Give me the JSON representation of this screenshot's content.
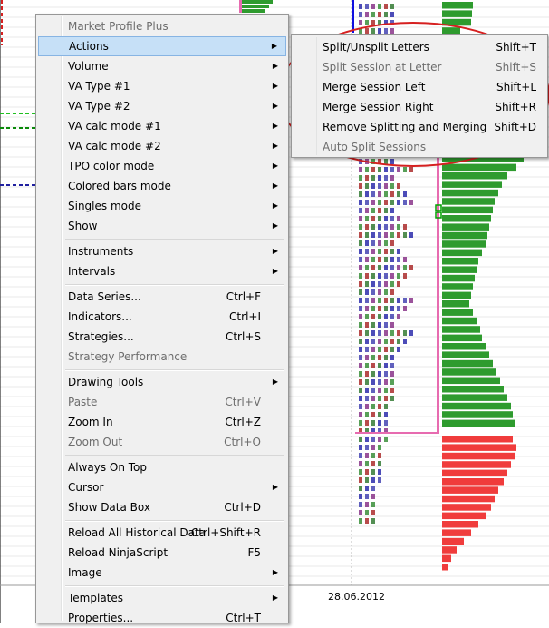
{
  "context_menu": {
    "items": [
      {
        "label": "Market Profile Plus",
        "shortcut": "",
        "submenu": false,
        "disabled": true
      },
      {
        "label": "Actions",
        "shortcut": "",
        "submenu": true,
        "disabled": false,
        "highlighted": true
      },
      {
        "label": "Volume",
        "shortcut": "",
        "submenu": true,
        "disabled": false
      },
      {
        "label": "VA Type #1",
        "shortcut": "",
        "submenu": true,
        "disabled": false
      },
      {
        "label": "VA Type #2",
        "shortcut": "",
        "submenu": true,
        "disabled": false
      },
      {
        "label": "VA calc mode #1",
        "shortcut": "",
        "submenu": true,
        "disabled": false
      },
      {
        "label": "VA calc mode #2",
        "shortcut": "",
        "submenu": true,
        "disabled": false
      },
      {
        "label": "TPO color mode",
        "shortcut": "",
        "submenu": true,
        "disabled": false
      },
      {
        "label": "Colored bars mode",
        "shortcut": "",
        "submenu": true,
        "disabled": false
      },
      {
        "label": "Singles mode",
        "shortcut": "",
        "submenu": true,
        "disabled": false
      },
      {
        "label": "Show",
        "shortcut": "",
        "submenu": true,
        "disabled": false
      },
      {
        "separator": true
      },
      {
        "label": "Instruments",
        "shortcut": "",
        "submenu": true,
        "disabled": false
      },
      {
        "label": "Intervals",
        "shortcut": "",
        "submenu": true,
        "disabled": false
      },
      {
        "separator": true
      },
      {
        "label": "Data Series...",
        "shortcut": "Ctrl+F",
        "submenu": false,
        "disabled": false
      },
      {
        "label": "Indicators...",
        "shortcut": "Ctrl+I",
        "submenu": false,
        "disabled": false
      },
      {
        "label": "Strategies...",
        "shortcut": "Ctrl+S",
        "submenu": false,
        "disabled": false
      },
      {
        "label": "Strategy Performance",
        "shortcut": "",
        "submenu": false,
        "disabled": true
      },
      {
        "separator": true
      },
      {
        "label": "Drawing Tools",
        "shortcut": "",
        "submenu": true,
        "disabled": false
      },
      {
        "label": "Paste",
        "shortcut": "Ctrl+V",
        "submenu": false,
        "disabled": true
      },
      {
        "label": "Zoom In",
        "shortcut": "Ctrl+Z",
        "submenu": false,
        "disabled": false
      },
      {
        "label": "Zoom Out",
        "shortcut": "Ctrl+O",
        "submenu": false,
        "disabled": true
      },
      {
        "separator": true
      },
      {
        "label": "Always On Top",
        "shortcut": "",
        "submenu": false,
        "disabled": false
      },
      {
        "label": "Cursor",
        "shortcut": "",
        "submenu": true,
        "disabled": false
      },
      {
        "label": "Show Data Box",
        "shortcut": "Ctrl+D",
        "submenu": false,
        "disabled": false
      },
      {
        "separator": true
      },
      {
        "label": "Reload All Historical Data",
        "shortcut": "Ctrl+Shift+R",
        "submenu": false,
        "disabled": false
      },
      {
        "label": "Reload NinjaScript",
        "shortcut": "F5",
        "submenu": false,
        "disabled": false
      },
      {
        "label": "Image",
        "shortcut": "",
        "submenu": true,
        "disabled": false
      },
      {
        "separator": true
      },
      {
        "label": "Templates",
        "shortcut": "",
        "submenu": true,
        "disabled": false
      },
      {
        "label": "Properties...",
        "shortcut": "Ctrl+T",
        "submenu": false,
        "disabled": false
      }
    ]
  },
  "actions_submenu": {
    "items": [
      {
        "label": "Split/Unsplit Letters",
        "shortcut": "Shift+T",
        "disabled": false
      },
      {
        "label": "Split Session at Letter",
        "shortcut": "Shift+S",
        "disabled": true
      },
      {
        "label": "Merge Session Left",
        "shortcut": "Shift+L",
        "disabled": false
      },
      {
        "label": "Merge Session Right",
        "shortcut": "Shift+R",
        "disabled": false
      },
      {
        "label": "Remove Splitting and Merging",
        "shortcut": "Shift+D",
        "disabled": false
      },
      {
        "label": "Auto Split Sessions",
        "shortcut": "",
        "disabled": true
      }
    ]
  },
  "chart": {
    "date_label": "28.06.2012",
    "colors": {
      "buy_bars": "#2e9b2e",
      "sell_bars": "#f03c3c",
      "value_area_line": "#e76bb0",
      "annotation": "#d62020",
      "grid": "#e8e8e8"
    },
    "volume_profile": {
      "green_widths": [
        34,
        33,
        32,
        20,
        12,
        12,
        10,
        20,
        18,
        26,
        32,
        38,
        44,
        60,
        75,
        82,
        100,
        95,
        90,
        82,
        72,
        66,
        62,
        58,
        56,
        54,
        52,
        50,
        48,
        44,
        40,
        38,
        36,
        34,
        32,
        30,
        34,
        38,
        42,
        44,
        48,
        52,
        56,
        60,
        64,
        68,
        72,
        76,
        78,
        80
      ],
      "red_widths": [
        78,
        82,
        80,
        76,
        72,
        68,
        62,
        58,
        54,
        48,
        40,
        32,
        24,
        16,
        10,
        6
      ]
    }
  }
}
